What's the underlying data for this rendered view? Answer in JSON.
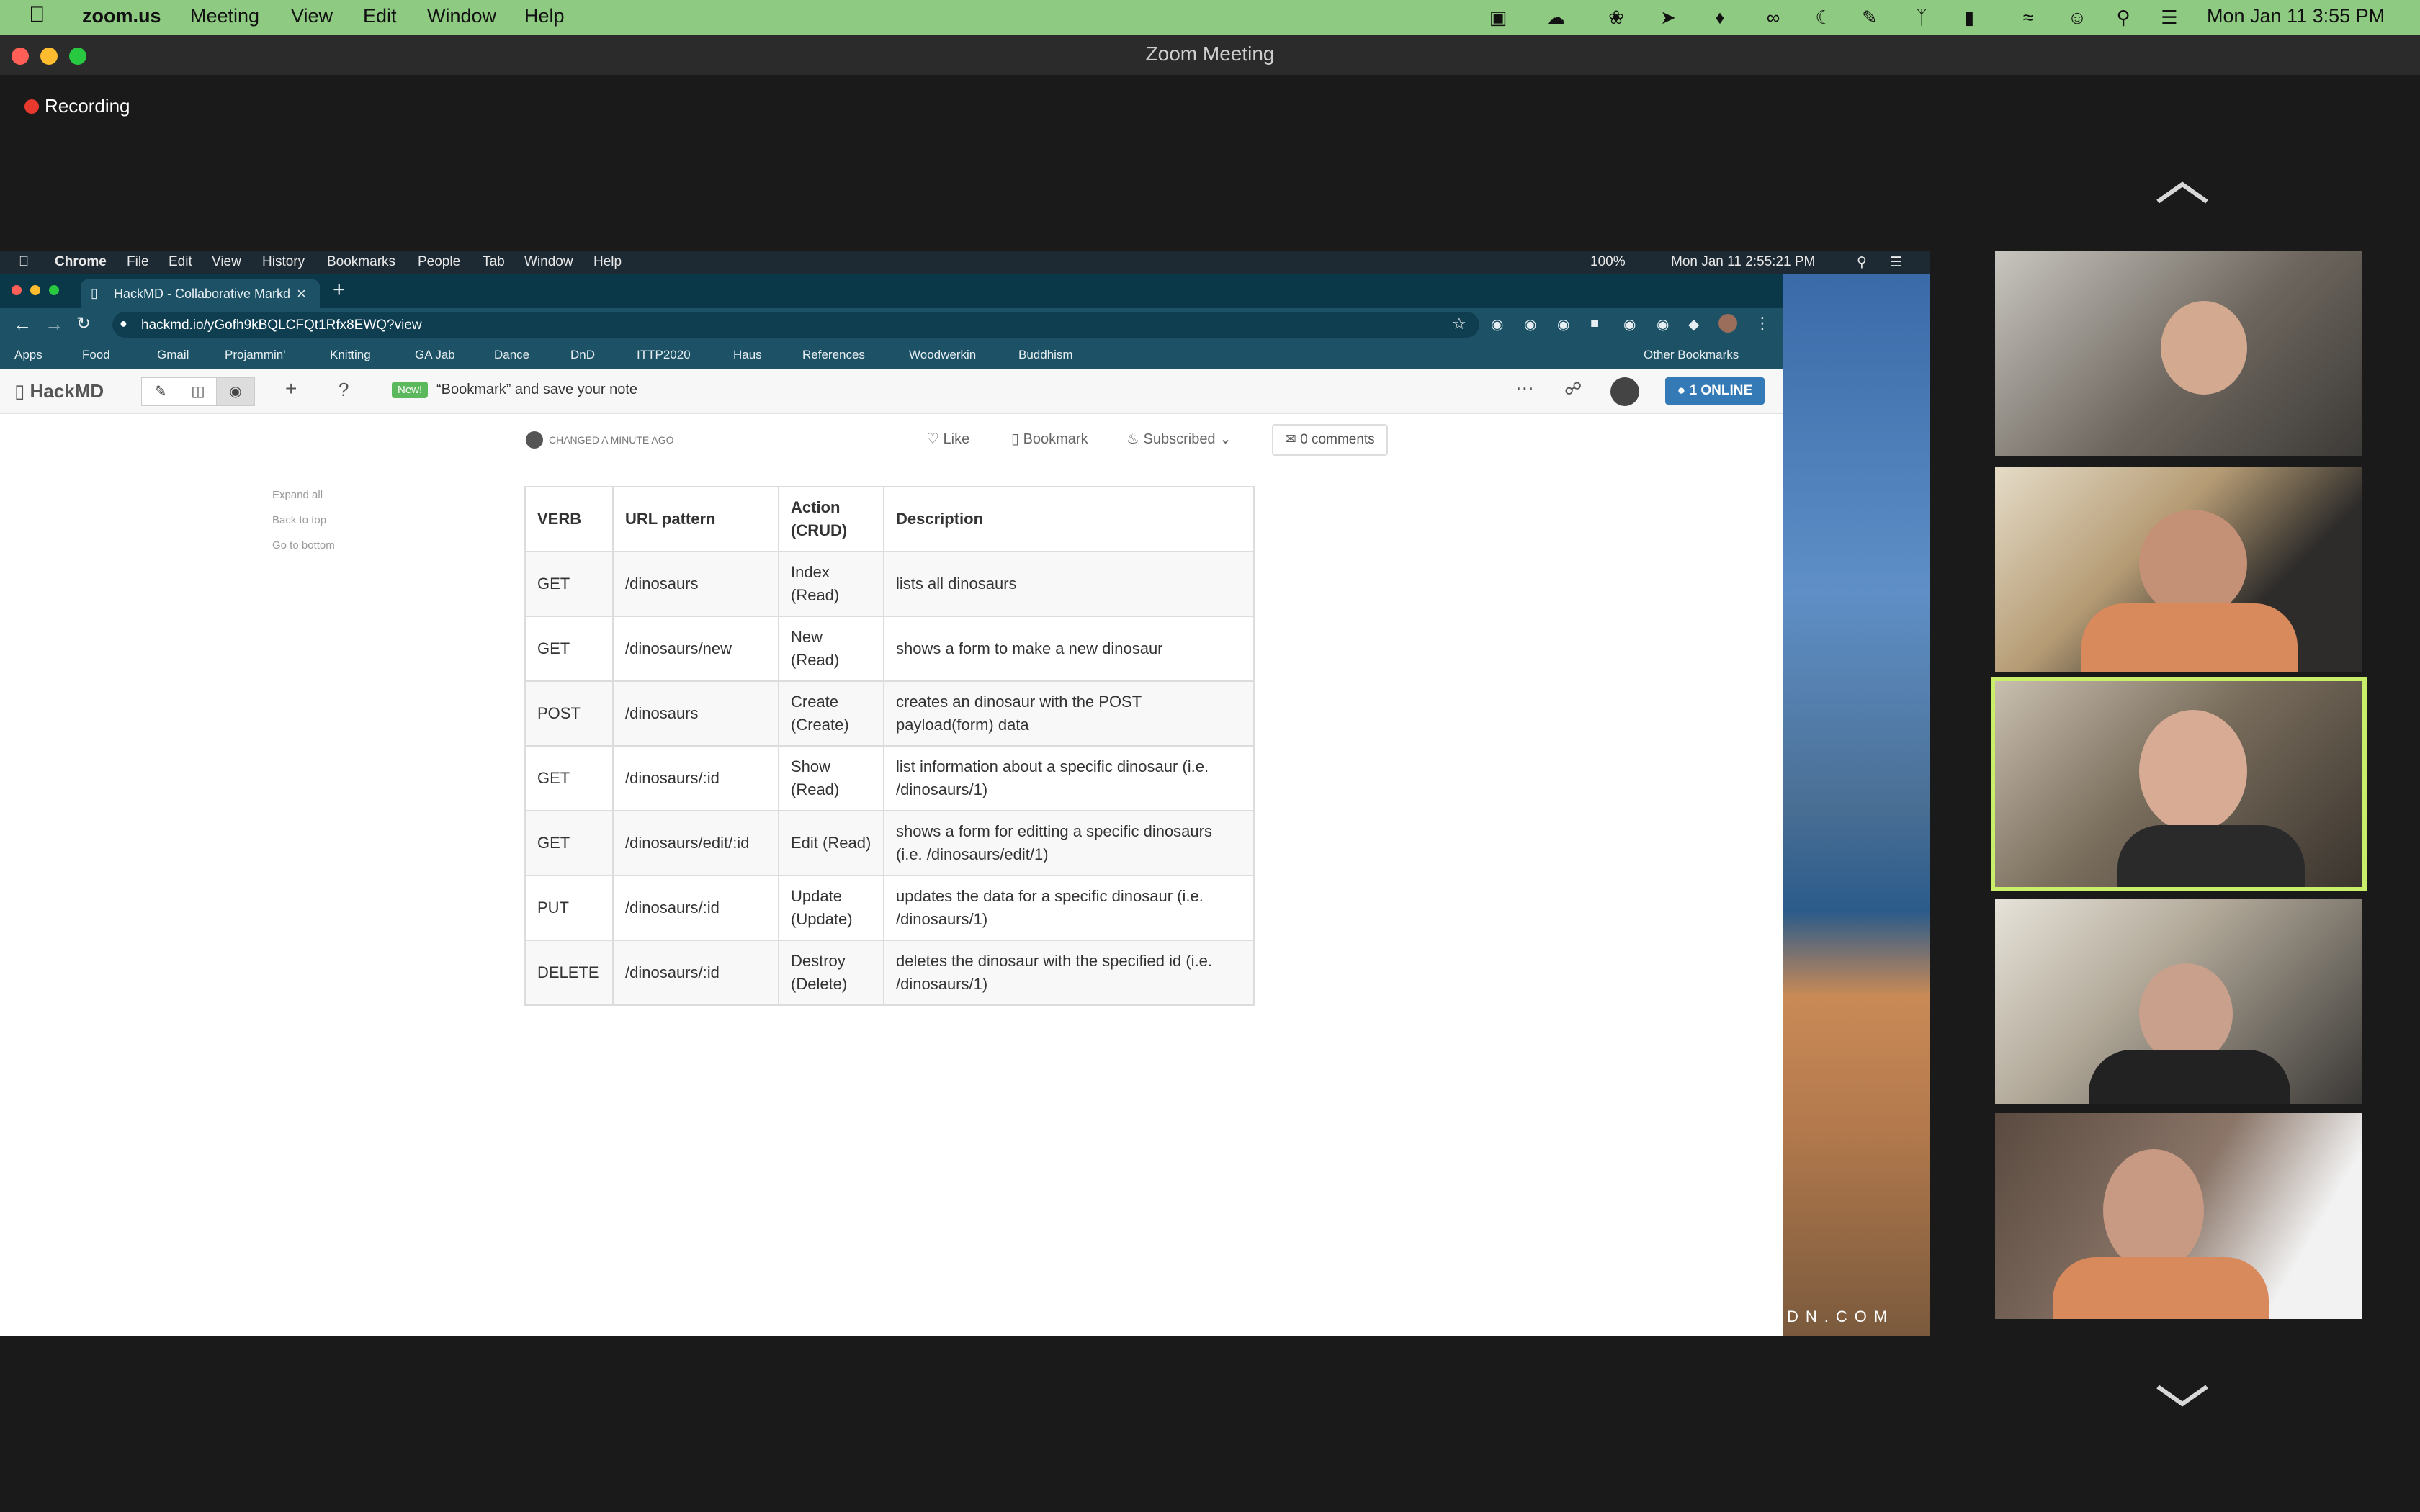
{
  "mac_menubar": {
    "app": "zoom.us",
    "items": [
      "Meeting",
      "View",
      "Edit",
      "Window",
      "Help"
    ],
    "clock": "Mon Jan 11  3:55 PM"
  },
  "zoom": {
    "window_title": "Zoom Meeting",
    "recording_label": "Recording"
  },
  "inner_mac": {
    "app": "Chrome",
    "items": [
      "File",
      "Edit",
      "View",
      "History",
      "Bookmarks",
      "People",
      "Tab",
      "Window",
      "Help"
    ],
    "battery": "100%",
    "clock": "Mon Jan 11  2:55:21 PM"
  },
  "browser": {
    "tab_title": "HackMD - Collaborative Markd",
    "url": "hackmd.io/yGofh9kBQLCFQt1Rfx8EWQ?view",
    "bookmarks": [
      "Apps",
      "Food",
      "Gmail",
      "Projammin'",
      "Knitting",
      "GA Jab",
      "Dance",
      "DnD",
      "ITTP2020",
      "Haus",
      "References",
      "Woodwerkin",
      "Buddhism"
    ],
    "other_bookmarks": "Other Bookmarks"
  },
  "hackmd": {
    "brand": "HackMD",
    "new_badge": "New!",
    "promo": "“Bookmark” and save your note",
    "online": "1 ONLINE",
    "changed": "CHANGED A MINUTE AGO",
    "like": "Like",
    "bookmark": "Bookmark",
    "subscribed": "Subscribed",
    "comments": "0 comments",
    "toc": [
      "Expand all",
      "Back to top",
      "Go to bottom"
    ],
    "table": {
      "headers": [
        "VERB",
        "URL pattern",
        "Action (CRUD)",
        "Description"
      ],
      "rows": [
        [
          "GET",
          "/dinosaurs",
          "Index (Read)",
          "lists all dinosaurs"
        ],
        [
          "GET",
          "/dinosaurs/new",
          "New (Read)",
          "shows a form to make a new dinosaur"
        ],
        [
          "POST",
          "/dinosaurs",
          "Create (Create)",
          "creates an dinosaur with the POST payload(form) data"
        ],
        [
          "GET",
          "/dinosaurs/:id",
          "Show (Read)",
          "list information about a specific dinosaur (i.e. /dinosaurs/1)"
        ],
        [
          "GET",
          "/dinosaurs/edit/:id",
          "Edit (Read)",
          "shows a form for editting a specific dinosaurs (i.e. /dinosaurs/edit/1)"
        ],
        [
          "PUT",
          "/dinosaurs/:id",
          "Update (Update)",
          "updates the data for a specific dinosaur (i.e. /dinosaurs/1)"
        ],
        [
          "DELETE",
          "/dinosaurs/:id",
          "Destroy (Delete)",
          "deletes the dinosaur with the specified id (i.e. /dinosaurs/1)"
        ]
      ]
    }
  },
  "desktop_watermark": "DN.COM"
}
